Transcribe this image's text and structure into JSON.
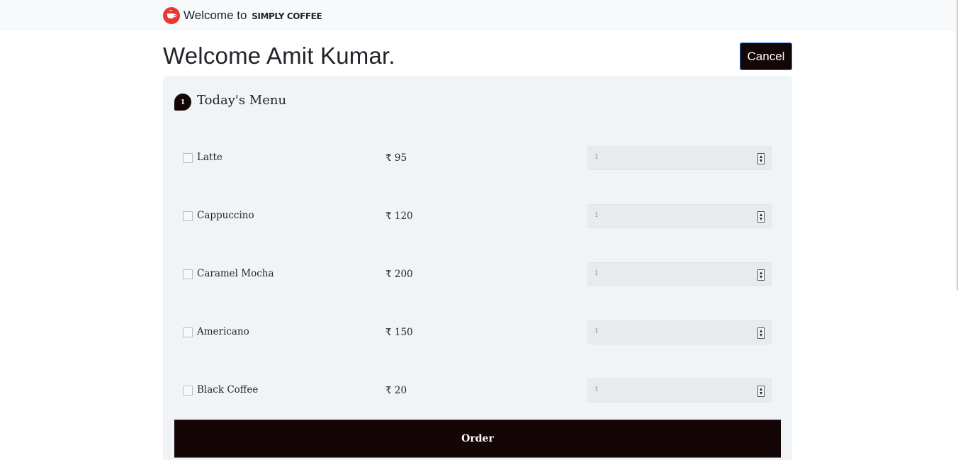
{
  "navbar": {
    "welcome_prefix": "Welcome to",
    "brand_name": "SIMPLY COFFEE",
    "logo_icon": "coffee-cup-icon"
  },
  "header": {
    "title": "Welcome Amit Kumar.",
    "cancel_label": "Cancel"
  },
  "menu": {
    "step": "1",
    "title": "Today's Menu",
    "items": [
      {
        "name": "Latte",
        "price": "₹ 95",
        "quantity": "1",
        "checked": false
      },
      {
        "name": "Cappuccino",
        "price": "₹ 120",
        "quantity": "1",
        "checked": false
      },
      {
        "name": "Caramel Mocha",
        "price": "₹ 200",
        "quantity": "1",
        "checked": false
      },
      {
        "name": "Americano",
        "price": "₹ 150",
        "quantity": "1",
        "checked": false
      },
      {
        "name": "Black Coffee",
        "price": "₹ 20",
        "quantity": "1",
        "checked": false
      }
    ],
    "order_label": "Order"
  },
  "colors": {
    "dark_button": "#140606",
    "logo_red": "#e53935",
    "card_bg": "#f1f4f6"
  }
}
